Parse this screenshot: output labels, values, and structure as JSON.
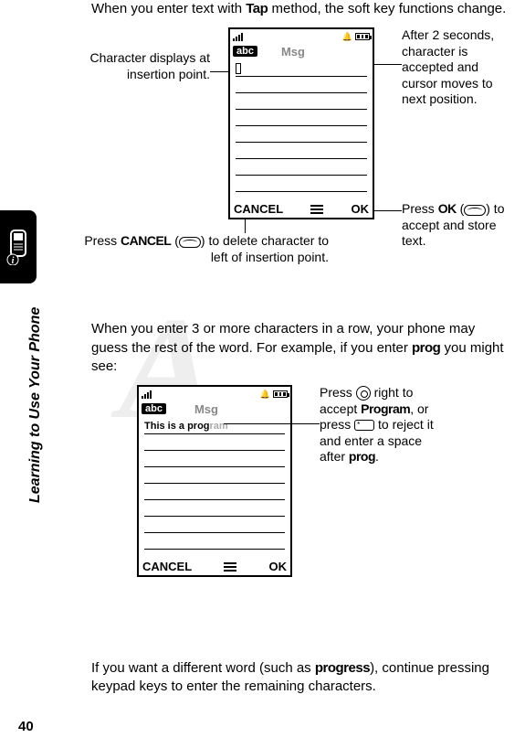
{
  "section_label": "Learning to Use Your Phone",
  "page_number": "40",
  "para1_pre": "When you enter text with ",
  "para1_bold": "Tap",
  "para1_post": " method, the soft key functions change.",
  "diagram1": {
    "callout_left": "Character displays at insertion point.",
    "callout_right": "After 2 seconds, character is accepted and cursor moves to next position.",
    "callout_ok_pre": "Press ",
    "callout_ok_bold": "OK",
    "callout_ok_post": " to accept and store text.",
    "callout_cancel_pre": "Press ",
    "callout_cancel_bold": "CANCEL",
    "callout_cancel_post": " to delete character to left of insertion point.",
    "screen": {
      "mode": "abc",
      "title": "Msg",
      "cancel": "CANCEL",
      "ok": "OK"
    }
  },
  "para2_pre": "When you enter 3 or more characters in a row, your phone may guess the rest of the word. For example, if you enter ",
  "para2_bold": "prog",
  "para2_post": " you might see:",
  "diagram2": {
    "callout_pre": "Press ",
    "callout_mid1": " right to accept ",
    "callout_bold1": "Program",
    "callout_mid2": ", or press ",
    "callout_mid3": " to reject it and enter a space after ",
    "callout_bold2": "prog",
    "callout_end": ".",
    "screen": {
      "mode": "abc",
      "title": "Msg",
      "typed": "This is a prog",
      "suggest": "ram",
      "cancel": "CANCEL",
      "ok": "OK"
    }
  },
  "para3_pre": "If you want a different word (such as ",
  "para3_bold": "progress",
  "para3_post": "), continue pressing keypad keys to enter the remaining characters."
}
